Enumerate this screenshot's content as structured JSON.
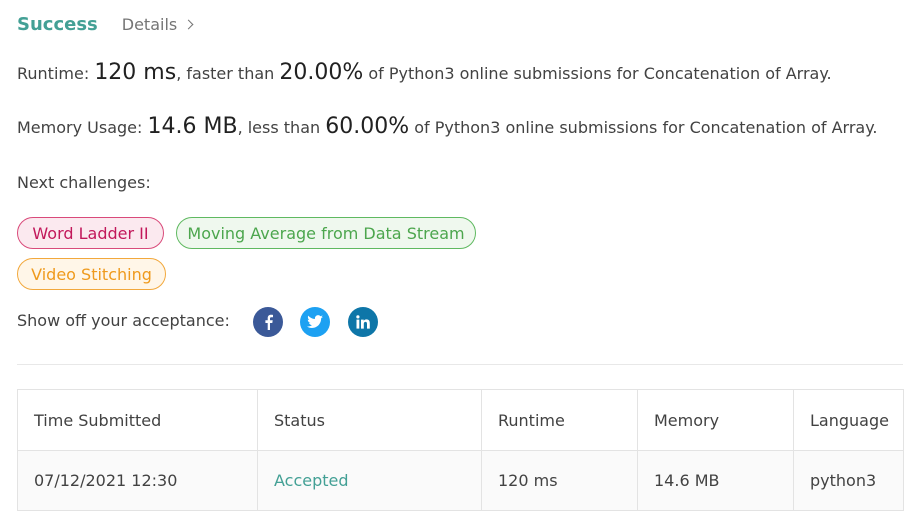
{
  "header": {
    "status_label": "Success",
    "details_label": "Details"
  },
  "runtime": {
    "label": "Runtime:",
    "value": "120 ms",
    "comparison_text": ", faster than",
    "percent": "20.00%",
    "suffix": "of Python3 online submissions for Concatenation of Array."
  },
  "memory": {
    "label": "Memory Usage:",
    "value": "14.6 MB",
    "comparison_text": ", less than",
    "percent": "60.00%",
    "suffix": "of Python3 online submissions for Concatenation of Array."
  },
  "next_challenges": {
    "label": "Next challenges:",
    "items": [
      {
        "title": "Word Ladder II",
        "difficulty_color": "#c2185b"
      },
      {
        "title": "Moving Average from Data Stream",
        "difficulty_color": "#4ca64d"
      },
      {
        "title": "Video Stitching",
        "difficulty_color": "#ef9a1d"
      }
    ]
  },
  "share": {
    "label": "Show off your acceptance:",
    "icons": [
      "facebook-icon",
      "twitter-icon",
      "linkedin-icon"
    ]
  },
  "table": {
    "headers": [
      "Time Submitted",
      "Status",
      "Runtime",
      "Memory",
      "Language"
    ],
    "rows": [
      [
        "07/12/2021 12:30",
        "Accepted",
        "120 ms",
        "14.6 MB",
        "python3"
      ]
    ]
  },
  "colors": {
    "accent": "#43a095",
    "facebook": "#3b5998",
    "twitter": "#1da1f2",
    "linkedin": "#0e76a8"
  }
}
